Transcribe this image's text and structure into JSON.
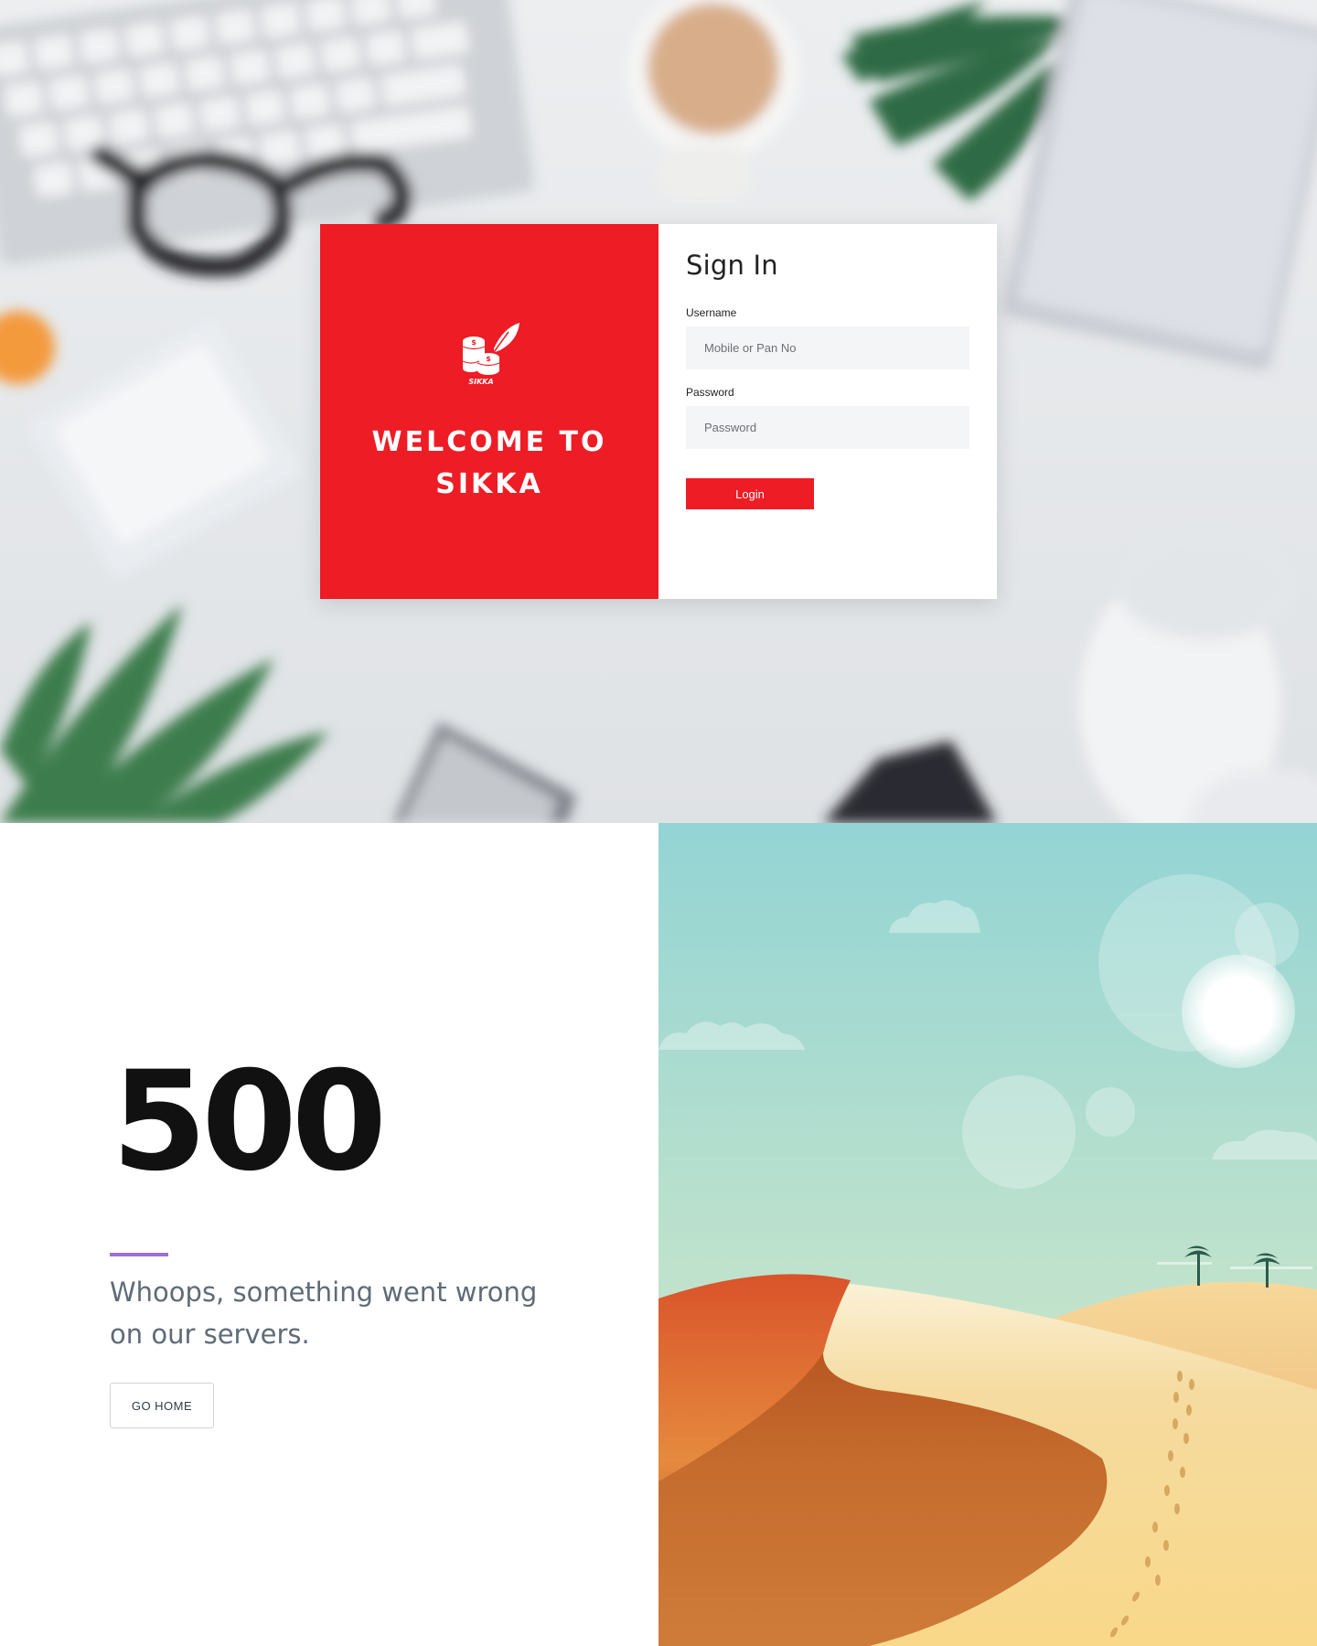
{
  "signin_card": {
    "logo_text": "SIKKA",
    "welcome_text": "WELCOME TO SIKKA",
    "title": "Sign In",
    "username": {
      "label": "Username",
      "placeholder": "Mobile or Pan No",
      "value": ""
    },
    "password": {
      "label": "Password",
      "placeholder": "Password",
      "value": ""
    },
    "login_label": "Login"
  },
  "error_page": {
    "code": "500",
    "message": "Whoops, something went wrong on our servers.",
    "home_label": "GO HOME"
  },
  "colors": {
    "brand_red": "#ee1c25",
    "accent_purple": "#9b6fd6",
    "message_text": "#5f6b78"
  },
  "icons": [
    "sikka-coins-logo-icon",
    "feather-quill-icon"
  ]
}
